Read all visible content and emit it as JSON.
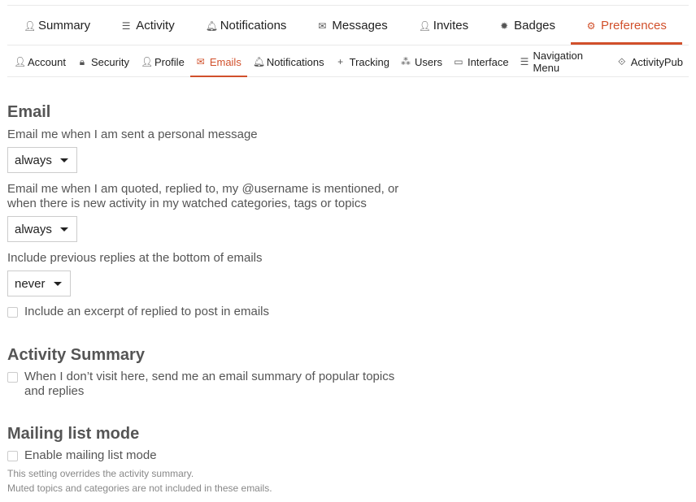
{
  "accent_color": "#d1502b",
  "top_nav": [
    {
      "label": "Summary",
      "icon": "user-icon"
    },
    {
      "label": "Activity",
      "icon": "list-icon"
    },
    {
      "label": "Notifications",
      "icon": "bell-icon"
    },
    {
      "label": "Messages",
      "icon": "envelope-icon"
    },
    {
      "label": "Invites",
      "icon": "user-plus-icon"
    },
    {
      "label": "Badges",
      "icon": "certificate-icon"
    },
    {
      "label": "Preferences",
      "icon": "gear-icon",
      "active": true
    }
  ],
  "sub_nav": [
    {
      "label": "Account",
      "icon": "user-icon"
    },
    {
      "label": "Security",
      "icon": "lock-icon"
    },
    {
      "label": "Profile",
      "icon": "user-icon"
    },
    {
      "label": "Emails",
      "icon": "envelope-icon",
      "active": true
    },
    {
      "label": "Notifications",
      "icon": "bell-icon"
    },
    {
      "label": "Tracking",
      "icon": "plus-icon"
    },
    {
      "label": "Users",
      "icon": "users-icon"
    },
    {
      "label": "Interface",
      "icon": "desktop-icon"
    },
    {
      "label": "Navigation Menu",
      "icon": "bars-icon"
    },
    {
      "label": "ActivityPub",
      "icon": "activitypub-icon"
    }
  ],
  "email": {
    "heading": "Email",
    "pm_label": "Email me when I am sent a personal message",
    "pm_value": "always",
    "mention_label": "Email me when I am quoted, replied to, my @username is mentioned, or when there is new activity in my watched categories, tags or topics",
    "mention_value": "always",
    "previous_label": "Include previous replies at the bottom of emails",
    "previous_value": "never",
    "excerpt_label": "Include an excerpt of replied to post in emails",
    "excerpt_checked": false
  },
  "summary": {
    "heading": "Activity Summary",
    "digest_label": "When I don’t visit here, send me an email summary of popular topics and replies",
    "digest_checked": false
  },
  "mailing": {
    "heading": "Mailing list mode",
    "enable_label": "Enable mailing list mode",
    "enable_checked": false,
    "note1": "This setting overrides the activity summary.",
    "note2": "Muted topics and categories are not included in these emails."
  }
}
